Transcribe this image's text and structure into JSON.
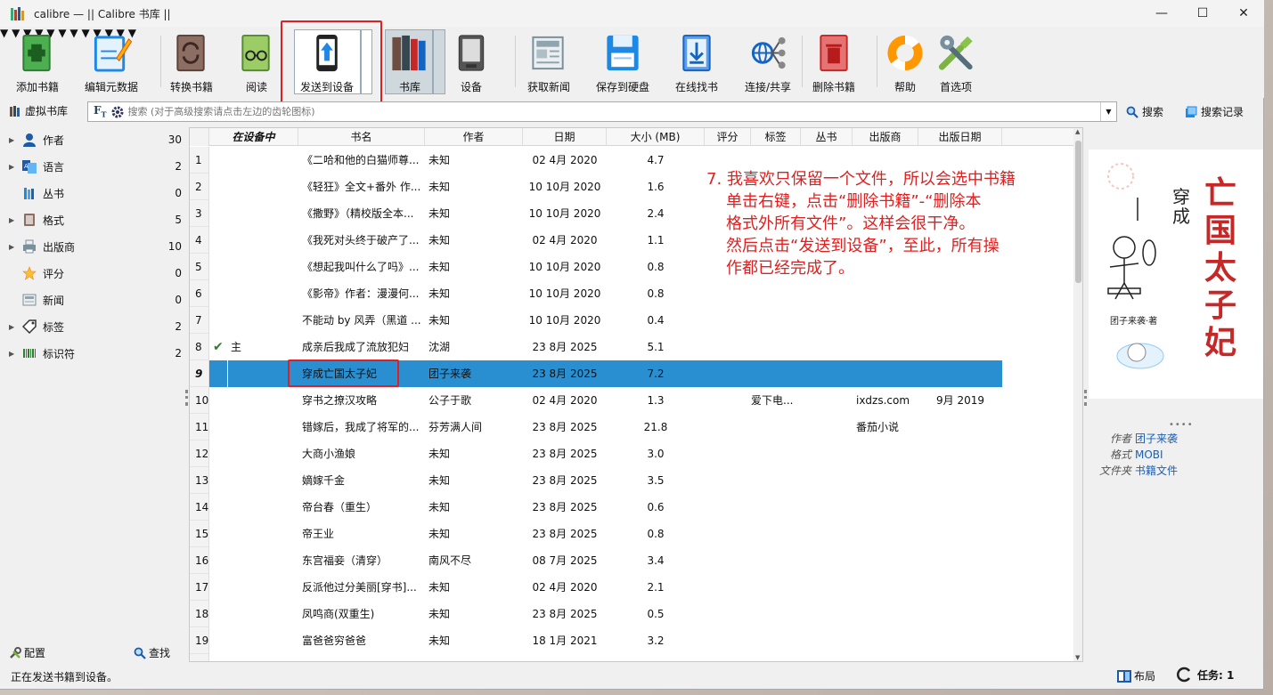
{
  "window": {
    "title": "calibre — || Calibre 书库 ||",
    "controls": [
      "—",
      "☐",
      "✕"
    ]
  },
  "toolbar": {
    "add": "添加书籍",
    "edit": "编辑元数据",
    "convert": "转换书籍",
    "read": "阅读",
    "send": "发送到设备",
    "library": "书库",
    "device": "设备",
    "news": "获取新闻",
    "save": "保存到硬盘",
    "getbooks": "在线找书",
    "connect": "连接/共享",
    "remove": "删除书籍",
    "help": "帮助",
    "prefs": "首选项"
  },
  "searchbar": {
    "virtual_library": "虚拟书库",
    "placeholder": "搜索 (对于高级搜索请点击左边的齿轮图标)",
    "search_btn": "搜索",
    "saved_btn": "搜索记录"
  },
  "tag_browser": {
    "items": [
      {
        "name": "作者",
        "count": "30",
        "expandable": true,
        "icon": "user-icon"
      },
      {
        "name": "语言",
        "count": "2",
        "expandable": true,
        "icon": "language-icon"
      },
      {
        "name": "丛书",
        "count": "0",
        "expandable": false,
        "icon": "series-icon"
      },
      {
        "name": "格式",
        "count": "5",
        "expandable": true,
        "icon": "format-icon"
      },
      {
        "name": "出版商",
        "count": "10",
        "expandable": true,
        "icon": "publisher-icon"
      },
      {
        "name": "评分",
        "count": "0",
        "expandable": false,
        "icon": "star-icon"
      },
      {
        "name": "新闻",
        "count": "0",
        "expandable": false,
        "icon": "news-icon"
      },
      {
        "name": "标签",
        "count": "2",
        "expandable": true,
        "icon": "tag-icon"
      },
      {
        "name": "标识符",
        "count": "2",
        "expandable": true,
        "icon": "barcode-icon"
      }
    ],
    "configure": "配置",
    "find": "查找"
  },
  "table": {
    "columns": [
      "在设备中",
      "书名",
      "作者",
      "日期",
      "大小 (MB)",
      "评分",
      "标签",
      "丛书",
      "出版商",
      "出版日期"
    ],
    "rows": [
      {
        "n": "1",
        "ondevice": "",
        "title": "《二哈和他的白猫师尊...",
        "author": "未知",
        "date": "02 4月 2020",
        "size": "4.7",
        "tags": "",
        "publisher": "",
        "pubdate": ""
      },
      {
        "n": "2",
        "ondevice": "",
        "title": "《轻狂》全文+番外 作...",
        "author": "未知",
        "date": "10 10月 2020",
        "size": "1.6",
        "tags": "",
        "publisher": "",
        "pubdate": ""
      },
      {
        "n": "3",
        "ondevice": "",
        "title": "《撒野》（精校版全本...",
        "author": "未知",
        "date": "10 10月 2020",
        "size": "2.4",
        "tags": "",
        "publisher": "",
        "pubdate": ""
      },
      {
        "n": "4",
        "ondevice": "",
        "title": "《我死对头终于破产了...",
        "author": "未知",
        "date": "02 4月 2020",
        "size": "1.1",
        "tags": "",
        "publisher": "",
        "pubdate": ""
      },
      {
        "n": "5",
        "ondevice": "",
        "title": "《想起我叫什么了吗》...",
        "author": "未知",
        "date": "10 10月 2020",
        "size": "0.8",
        "tags": "",
        "publisher": "",
        "pubdate": ""
      },
      {
        "n": "6",
        "ondevice": "",
        "title": "《影帝》作者：漫漫何...",
        "author": "未知",
        "date": "10 10月 2020",
        "size": "0.8",
        "tags": "",
        "publisher": "",
        "pubdate": ""
      },
      {
        "n": "7",
        "ondevice": "",
        "title": "不能动 by 风弄（黑道 ...",
        "author": "未知",
        "date": "10 10月 2020",
        "size": "0.4",
        "tags": "",
        "publisher": "",
        "pubdate": ""
      },
      {
        "n": "8",
        "ondevice": "主",
        "title": "成亲后我成了流放犯妇",
        "author": "沈湖",
        "date": "23 8月 2025",
        "size": "5.1",
        "tags": "",
        "publisher": "",
        "pubdate": ""
      },
      {
        "n": "9",
        "ondevice": "",
        "title": "穿成亡国太子妃",
        "author": "团子来袭",
        "date": "23 8月 2025",
        "size": "7.2",
        "tags": "",
        "publisher": "",
        "pubdate": ""
      },
      {
        "n": "10",
        "ondevice": "",
        "title": "穿书之撩汉攻略",
        "author": "公子于歌",
        "date": "02 4月 2020",
        "size": "1.3",
        "tags": "爱下电...",
        "publisher": "ixdzs.com",
        "pubdate": "9月 2019"
      },
      {
        "n": "11",
        "ondevice": "",
        "title": "错嫁后，我成了将军的...",
        "author": "芬芳满人间",
        "date": "23 8月 2025",
        "size": "21.8",
        "tags": "",
        "publisher": "番茄小说",
        "pubdate": ""
      },
      {
        "n": "12",
        "ondevice": "",
        "title": "大商小渔娘",
        "author": "未知",
        "date": "23 8月 2025",
        "size": "3.0",
        "tags": "",
        "publisher": "",
        "pubdate": ""
      },
      {
        "n": "13",
        "ondevice": "",
        "title": "嫡嫁千金",
        "author": "未知",
        "date": "23 8月 2025",
        "size": "3.5",
        "tags": "",
        "publisher": "",
        "pubdate": ""
      },
      {
        "n": "14",
        "ondevice": "",
        "title": "帝台春（重生）",
        "author": "未知",
        "date": "23 8月 2025",
        "size": "0.6",
        "tags": "",
        "publisher": "",
        "pubdate": ""
      },
      {
        "n": "15",
        "ondevice": "",
        "title": "帝王业",
        "author": "未知",
        "date": "23 8月 2025",
        "size": "0.8",
        "tags": "",
        "publisher": "",
        "pubdate": ""
      },
      {
        "n": "16",
        "ondevice": "",
        "title": "东宫福妾（清穿）",
        "author": "南风不尽",
        "date": "08 7月 2025",
        "size": "3.4",
        "tags": "",
        "publisher": "",
        "pubdate": ""
      },
      {
        "n": "17",
        "ondevice": "",
        "title": "反派他过分美丽[穿书]...",
        "author": "未知",
        "date": "02 4月 2020",
        "size": "2.1",
        "tags": "",
        "publisher": "",
        "pubdate": ""
      },
      {
        "n": "18",
        "ondevice": "",
        "title": "凤鸣商(双重生)",
        "author": "未知",
        "date": "23 8月 2025",
        "size": "0.5",
        "tags": "",
        "publisher": "",
        "pubdate": ""
      },
      {
        "n": "19",
        "ondevice": "",
        "title": "富爸爸穷爸爸",
        "author": "未知",
        "date": "18 1月 2021",
        "size": "3.2",
        "tags": "",
        "publisher": "",
        "pubdate": ""
      }
    ],
    "selected_row": "9"
  },
  "annotation": {
    "lines": [
      "7. 我喜欢只保留一个文件，所以会选中书籍",
      "单击右键，点击“删除书籍”-“删除本",
      "格式外所有文件”。这样会很干净。",
      "然后点击“发送到设备”，至此，所有操",
      "作都已经完成了。"
    ]
  },
  "cover": {
    "title_chars": [
      "亡",
      "国",
      "太",
      "子",
      "妃"
    ],
    "small": [
      "穿",
      "成"
    ],
    "author": "团子来袭·著"
  },
  "details": {
    "author_label": "作者",
    "author": "团子来袭",
    "format_label": "格式",
    "format": "MOBI",
    "folder_label": "文件夹",
    "folder": "书籍文件"
  },
  "statusbar": {
    "message": "正在发送书籍到设备。",
    "layout": "布局",
    "jobs": "任务:  1"
  },
  "colors": {
    "selection": "#2a8fd0",
    "annotation": "#e02020",
    "link": "#1a5fb4"
  }
}
